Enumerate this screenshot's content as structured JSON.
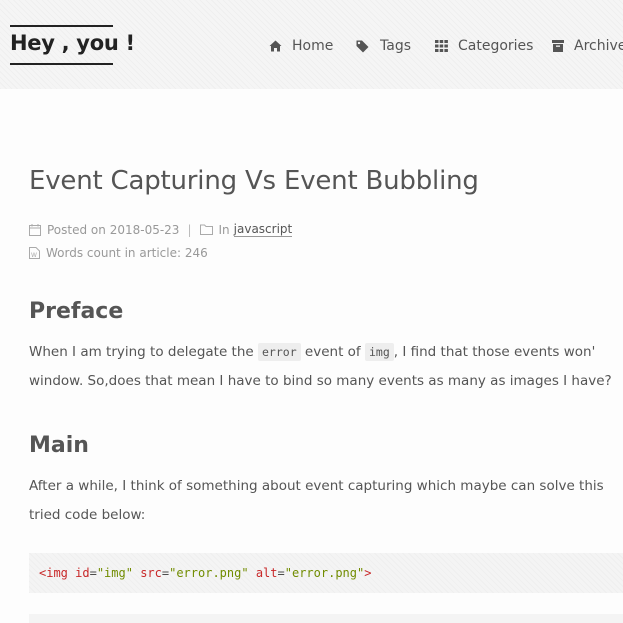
{
  "site": {
    "title": "Hey , you !"
  },
  "nav": {
    "items": [
      {
        "label": "Home",
        "icon": "home-icon"
      },
      {
        "label": "Tags",
        "icon": "tags-icon"
      },
      {
        "label": "Categories",
        "icon": "grid-icon"
      },
      {
        "label": "Archives",
        "icon": "archive-icon"
      }
    ]
  },
  "post": {
    "title": "Event Capturing Vs Event Bubbling",
    "posted_prefix": "Posted on",
    "posted_date": "2018-05-23",
    "separator": "|",
    "in_prefix": "In",
    "category": "javascript",
    "words_label": "Words count in article:",
    "words_count": "246"
  },
  "sections": {
    "preface": {
      "heading": "Preface",
      "line1_a": "When I am trying to delegate the ",
      "line1_code1": "error",
      "line1_b": " event of ",
      "line1_code2": "img",
      "line1_c": ", I find that those events won'",
      "line2": "window. So,does that mean I have to bind so many events as many as images I have?"
    },
    "main": {
      "heading": "Main",
      "line1": "After a while, I think of something about event capturing which maybe can solve this",
      "line2": "tried code below:"
    }
  },
  "code": {
    "tag_open": "<img",
    "attr1": "id",
    "val1": "\"img\"",
    "attr2": "src",
    "val2": "\"error.png\"",
    "attr3": "alt",
    "val3": "\"error.png\"",
    "tag_close": ">",
    "eq": "="
  },
  "colors": {
    "text": "#555555",
    "meta": "#999999",
    "code_tag": "#c82829",
    "code_string": "#718c00"
  }
}
